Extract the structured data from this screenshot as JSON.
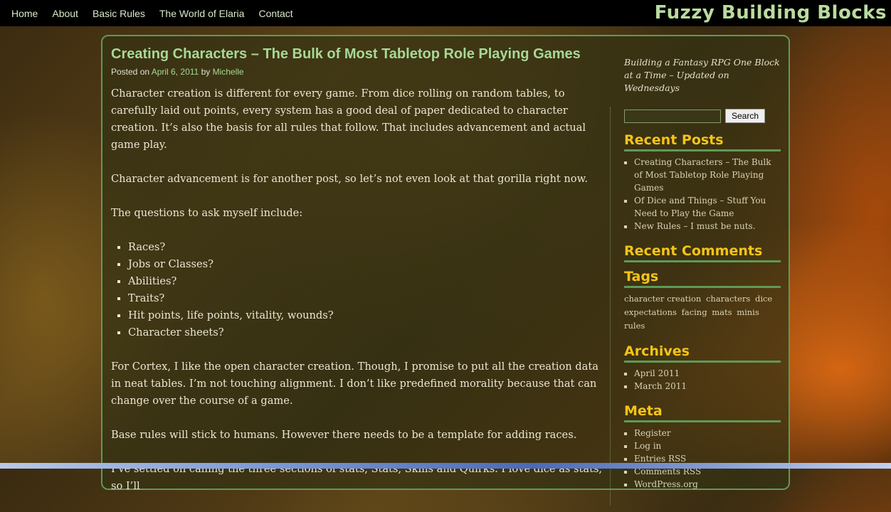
{
  "nav": {
    "items": [
      "Home",
      "About",
      "Basic Rules",
      "The World of Elaria",
      "Contact"
    ]
  },
  "site": {
    "title": "Fuzzy Building Blocks"
  },
  "post": {
    "title": "Creating Characters – The Bulk of Most Tabletop Role Playing Games",
    "posted_on_label": "Posted on",
    "date": "April 6, 2011",
    "by_label": "by",
    "author": "Michelle",
    "paragraphs": [
      "Character creation is different for every game. From dice rolling on random tables, to carefully laid out points, every system has a good deal of paper dedicated to character creation. It’s also the basis for all rules that follow. That includes advancement and actual game play.",
      "Character advancement is for another post, so let’s not even look at that gorilla right now.",
      "The questions to ask myself include:"
    ],
    "list": [
      "Races?",
      "Jobs or Classes?",
      "Abilities?",
      "Traits?",
      "Hit points, life points, vitality, wounds?",
      "Character sheets?"
    ],
    "paragraphs_after": [
      "For Cortex, I like the open character creation. Though, I promise to put all the creation data in neat tables. I’m not touching alignment. I don’t like predefined morality because that can change over the course of a game.",
      "Base rules will stick to humans. However there needs to be a template for adding races.",
      "I’ve settled on calling the three sections of stats, Stats, Skills and Quirks. I love dice as stats, so I’ll"
    ]
  },
  "sidebar": {
    "tagline": "Building a Fantasy RPG One Block at a Time – Updated on Wednesdays",
    "search_button": "Search",
    "recent_posts": {
      "title": "Recent Posts",
      "items": [
        "Creating Characters – The Bulk of Most Tabletop Role Playing Games",
        "Of Dice and Things – Stuff You Need to Play the Game",
        "New Rules – I must be nuts."
      ]
    },
    "recent_comments": {
      "title": "Recent Comments"
    },
    "tags": {
      "title": "Tags",
      "items": [
        "character creation",
        "characters",
        "dice",
        "expectations",
        "facing",
        "mats",
        "minis",
        "rules"
      ]
    },
    "archives": {
      "title": "Archives",
      "items": [
        "April 2011",
        "March 2011"
      ]
    },
    "meta": {
      "title": "Meta",
      "items": [
        "Register",
        "Log in",
        "Entries RSS",
        "Comments RSS",
        "WordPress.org"
      ]
    }
  },
  "colors": {
    "nav_bg": "#000000",
    "site_title": "#b9dba0",
    "post_title": "#a8d896",
    "widget_title": "#f4c418",
    "panel_border": "#5f9a55"
  }
}
